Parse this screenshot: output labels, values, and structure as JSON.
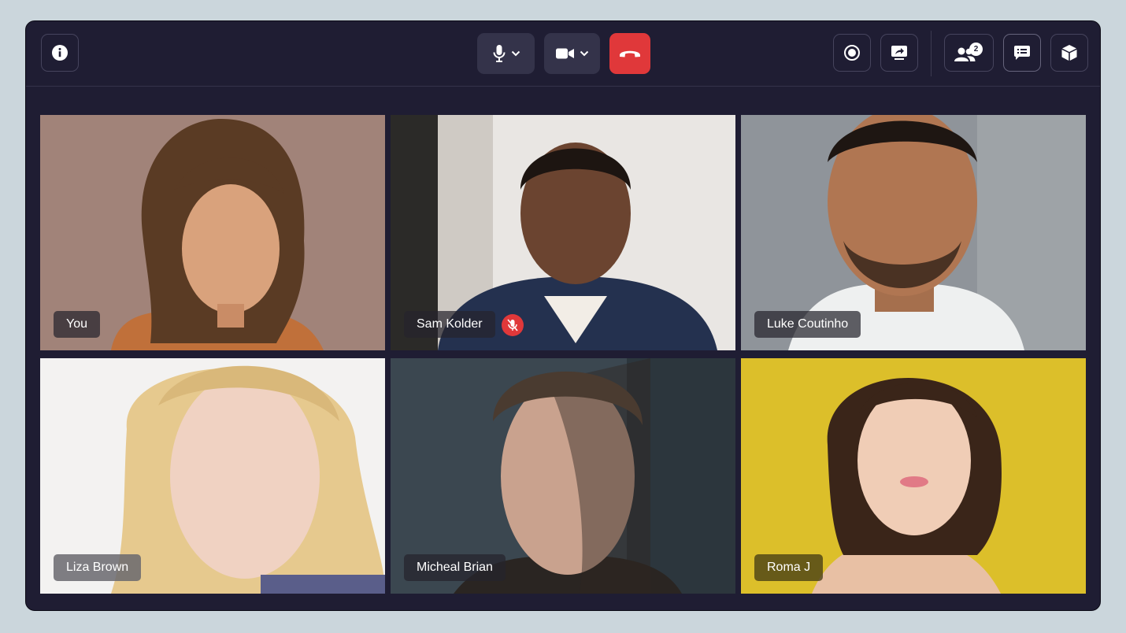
{
  "toolbar": {
    "info_button": {
      "icon": "info-icon"
    },
    "mic_button": {
      "icon": "microphone-icon"
    },
    "camera_button": {
      "icon": "video-camera-icon"
    },
    "end_call_button": {
      "icon": "phone-hangup-icon",
      "color": "#e0383a"
    },
    "record_button": {
      "icon": "record-icon"
    },
    "screen_share_button": {
      "icon": "screen-share-icon"
    },
    "participants_button": {
      "icon": "people-icon",
      "count": "2"
    },
    "chat_button": {
      "icon": "chat-list-icon"
    },
    "apps_button": {
      "icon": "cube-icon"
    }
  },
  "participants": [
    {
      "name": "You",
      "muted": false,
      "bg": "#9a7d73",
      "accent": "#c0703a"
    },
    {
      "name": "Sam Kolder",
      "muted": true,
      "bg": "#e9e6e3",
      "accent": "#24314f"
    },
    {
      "name": "Luke Coutinho",
      "muted": false,
      "bg": "#8f949a",
      "accent": "#eef0f0"
    },
    {
      "name": "Liza Brown",
      "muted": false,
      "bg": "#f3f2f1",
      "accent": "#e6c98e"
    },
    {
      "name": "Micheal Brian",
      "muted": false,
      "bg": "#3b4750",
      "accent": "#2a2522"
    },
    {
      "name": "Roma J",
      "muted": false,
      "bg": "#dcbf2a",
      "accent": "#3a2519"
    }
  ],
  "colors": {
    "window": "#1f1d33",
    "page": "#cbd6dc",
    "mute_badge": "#e0383a"
  }
}
